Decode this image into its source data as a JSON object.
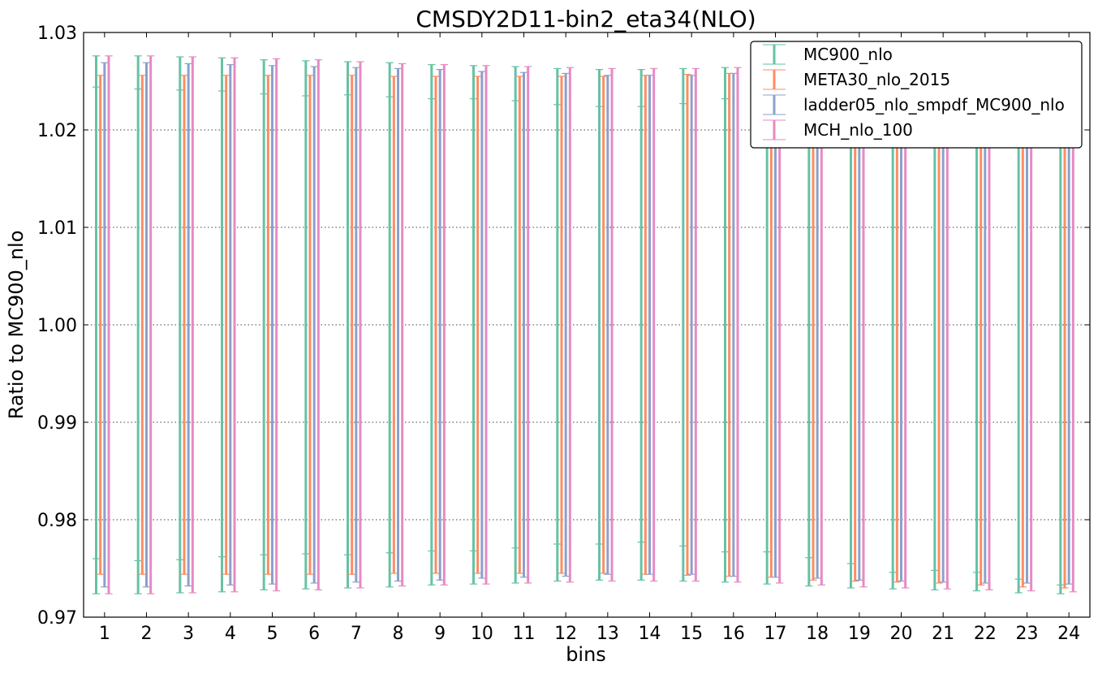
{
  "chart_data": {
    "type": "errorbar",
    "title": "CMSDY2D11-bin2_eta34(NLO)",
    "xlabel": "bins",
    "ylabel": "Ratio to MC900_nlo",
    "ylim": [
      0.97,
      1.03
    ],
    "xlim": [
      0.5,
      24.5
    ],
    "yticks": [
      "0.97",
      "0.98",
      "0.99",
      "1.00",
      "1.01",
      "1.02",
      "1.03"
    ],
    "categories": [
      "1",
      "2",
      "3",
      "4",
      "5",
      "6",
      "7",
      "8",
      "9",
      "10",
      "11",
      "12",
      "13",
      "14",
      "15",
      "16",
      "17",
      "18",
      "19",
      "20",
      "21",
      "22",
      "23",
      "24"
    ],
    "grid": "horizontal dotted",
    "legend_position": "top-right",
    "series": [
      {
        "name": "MC900_nlo",
        "color": "#66c2a5",
        "offset": -0.2,
        "upper": [
          1.0276,
          1.0276,
          1.0275,
          1.0274,
          1.0272,
          1.0271,
          1.027,
          1.0269,
          1.0267,
          1.0266,
          1.0265,
          1.0263,
          1.0262,
          1.0262,
          1.0263,
          1.0264,
          1.0266,
          1.0268,
          1.027,
          1.0271,
          1.0272,
          1.0273,
          1.0275,
          1.0276
        ],
        "lower": [
          0.9724,
          0.9724,
          0.9725,
          0.9726,
          0.9728,
          0.9729,
          0.973,
          0.9731,
          0.9733,
          0.9734,
          0.9735,
          0.9737,
          0.9738,
          0.9738,
          0.9737,
          0.9736,
          0.9734,
          0.9732,
          0.973,
          0.9729,
          0.9728,
          0.9727,
          0.9725,
          0.9724
        ],
        "inner_upper": [
          1.0244,
          1.0242,
          1.0241,
          1.024,
          1.0237,
          1.0235,
          1.0236,
          1.0234,
          1.0232,
          1.0232,
          1.023,
          1.0226,
          1.0224,
          1.0224,
          1.0227,
          1.0232,
          1.0235,
          1.0241,
          1.0245,
          1.0254,
          1.0253,
          1.0256,
          1.026,
          1.0267
        ],
        "inner_lower": [
          0.976,
          0.9758,
          0.9759,
          0.9762,
          0.9764,
          0.9765,
          0.9764,
          0.9766,
          0.9768,
          0.9768,
          0.9771,
          0.9775,
          0.9775,
          0.9777,
          0.9773,
          0.9767,
          0.9767,
          0.9761,
          0.9755,
          0.9746,
          0.9748,
          0.9746,
          0.9739,
          0.9733
        ]
      },
      {
        "name": "META30_nlo_2015",
        "color": "#fc8d62",
        "offset": -0.1,
        "upper": [
          1.0256,
          1.0256,
          1.0256,
          1.0256,
          1.0256,
          1.0256,
          1.0256,
          1.0255,
          1.0255,
          1.0255,
          1.0255,
          1.0255,
          1.0255,
          1.0256,
          1.0257,
          1.0258,
          1.0259,
          1.0262,
          1.0263,
          1.0264,
          1.0265,
          1.0266,
          1.0267,
          1.0268
        ],
        "lower": [
          0.9744,
          0.9744,
          0.9744,
          0.9744,
          0.9744,
          0.9744,
          0.9744,
          0.9745,
          0.9745,
          0.9745,
          0.9745,
          0.9745,
          0.9745,
          0.9744,
          0.9743,
          0.9742,
          0.9741,
          0.9738,
          0.9737,
          0.9736,
          0.9735,
          0.9733,
          0.9731,
          0.973
        ]
      },
      {
        "name": "ladder05_nlo_smpdf_MC900_nlo",
        "color": "#8da0cb",
        "offset": 0.0,
        "upper": [
          1.0269,
          1.0269,
          1.0268,
          1.0267,
          1.0266,
          1.0265,
          1.0264,
          1.0263,
          1.0262,
          1.026,
          1.0259,
          1.0258,
          1.0256,
          1.0256,
          1.0256,
          1.0258,
          1.0259,
          1.026,
          1.0262,
          1.0263,
          1.0264,
          1.0265,
          1.0265,
          1.0266
        ],
        "lower": [
          0.9731,
          0.9731,
          0.9732,
          0.9733,
          0.9734,
          0.9735,
          0.9736,
          0.9737,
          0.9738,
          0.974,
          0.9741,
          0.9742,
          0.9744,
          0.9744,
          0.9744,
          0.9742,
          0.9741,
          0.974,
          0.9738,
          0.9737,
          0.9736,
          0.9735,
          0.9735,
          0.9734
        ]
      },
      {
        "name": "MCH_nlo_100",
        "color": "#e78ac3",
        "offset": 0.1,
        "upper": [
          1.0276,
          1.0276,
          1.0275,
          1.0274,
          1.0273,
          1.0272,
          1.027,
          1.0268,
          1.0267,
          1.0266,
          1.0265,
          1.0264,
          1.0263,
          1.0263,
          1.0263,
          1.0264,
          1.0265,
          1.0267,
          1.0269,
          1.027,
          1.0271,
          1.0272,
          1.0273,
          1.0274
        ],
        "lower": [
          0.9724,
          0.9724,
          0.9725,
          0.9726,
          0.9727,
          0.9728,
          0.973,
          0.9732,
          0.9733,
          0.9734,
          0.9735,
          0.9736,
          0.9737,
          0.9737,
          0.9737,
          0.9736,
          0.9735,
          0.9733,
          0.9731,
          0.973,
          0.9729,
          0.9728,
          0.9727,
          0.9726
        ]
      }
    ]
  }
}
